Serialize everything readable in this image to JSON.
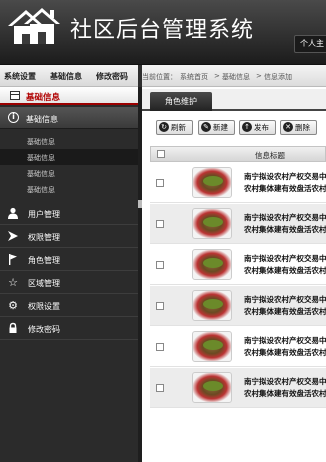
{
  "header": {
    "title": "社区后台管理系统",
    "user_label": "个人主"
  },
  "topnav": {
    "items": [
      "系统设置",
      "基础信息",
      "修改密码"
    ]
  },
  "sidebar": {
    "head_title": "基础信息",
    "section_title": "基础信息",
    "sub_items": [
      "基础信息",
      "基础信息",
      "基础信息",
      "基础信息"
    ],
    "menu_items": [
      "用户管理",
      "权限管理",
      "角色管理",
      "区域管理",
      "权限设置",
      "修改密码"
    ]
  },
  "breadcrumb": {
    "prefix": "当前位置：",
    "items": [
      "系统首页",
      "基础信息",
      "信息添加"
    ],
    "separator": ">"
  },
  "tab": {
    "label": "角色维护"
  },
  "toolbar": {
    "refresh": "刷新",
    "new": "新建",
    "publish": "发布",
    "delete": "删除"
  },
  "table": {
    "header": "信息标题",
    "rows": [
      {
        "line1": "南宁拟设农村产权交易中",
        "line2": "农村集体建有效盘活农村"
      },
      {
        "line1": "南宁拟设农村产权交易中",
        "line2": "农村集体建有效盘活农村"
      },
      {
        "line1": "南宁拟设农村产权交易中",
        "line2": "农村集体建有效盘活农村"
      },
      {
        "line1": "南宁拟设农村产权交易中",
        "line2": "农村集体建有效盘活农村"
      },
      {
        "line1": "南宁拟设农村产权交易中",
        "line2": "农村集体建有效盘活农村"
      },
      {
        "line1": "南宁拟设农村产权交易中",
        "line2": "农村集体建有效盘活农村"
      }
    ]
  },
  "colors": {
    "accent_red": "#b00000",
    "sidebar_bg": "#2b2b2b",
    "header_bg": "#1c1c1c"
  }
}
